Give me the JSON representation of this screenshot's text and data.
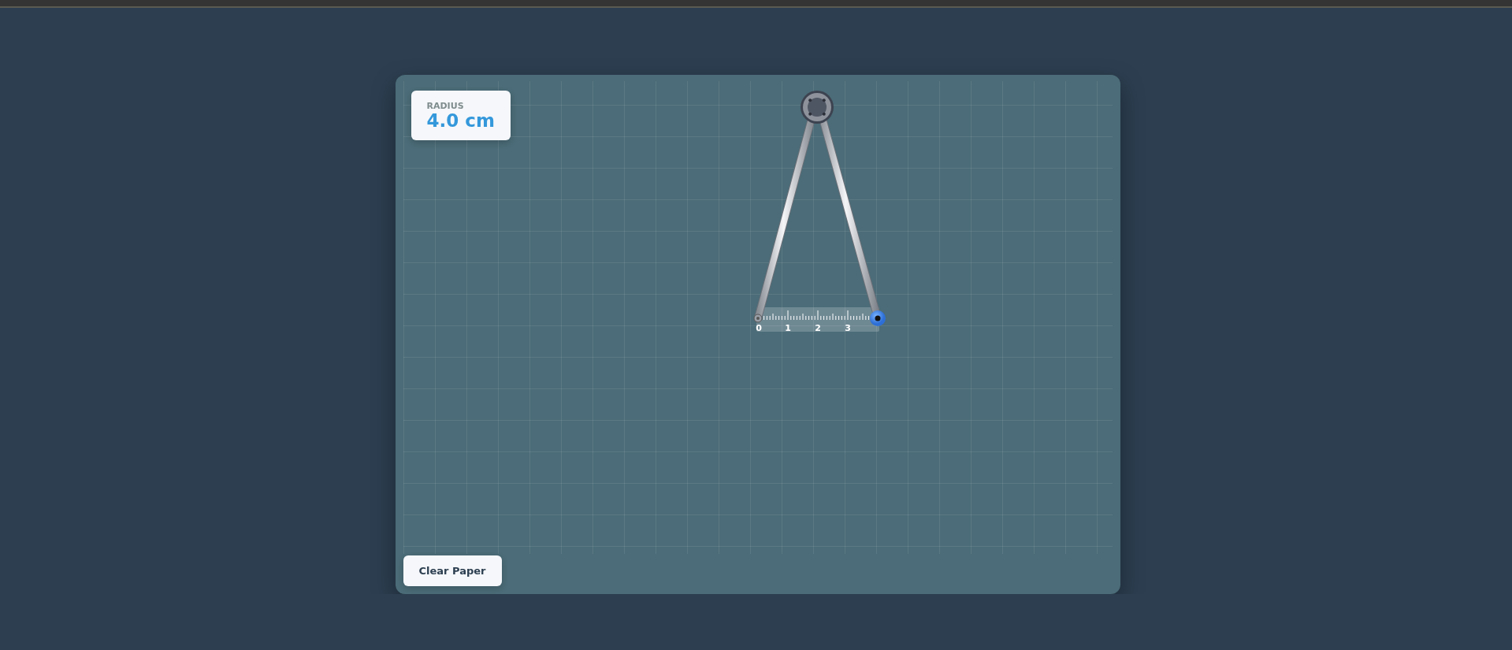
{
  "radius": {
    "label": "RADIUS",
    "value": "4.0 cm"
  },
  "ruler": {
    "labels": [
      "0",
      "1",
      "2",
      "3"
    ]
  },
  "button": {
    "label": "Clear Paper"
  }
}
